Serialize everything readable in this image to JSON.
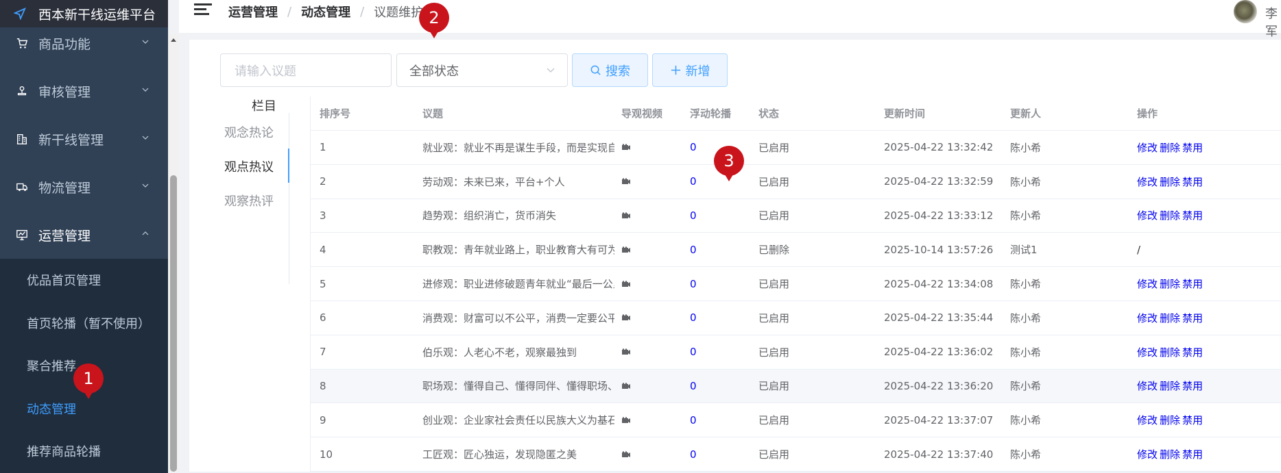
{
  "app_title": "西本新干线运维平台",
  "sidebar": {
    "items": [
      {
        "label": "商品功能",
        "icon": "cart-icon"
      },
      {
        "label": "审核管理",
        "icon": "stamp-icon"
      },
      {
        "label": "新干线管理",
        "icon": "building-icon"
      },
      {
        "label": "物流管理",
        "icon": "truck-icon"
      },
      {
        "label": "运营管理",
        "icon": "monitor-icon"
      }
    ],
    "subitems": [
      {
        "label": "优品首页管理"
      },
      {
        "label": "首页轮播（暂不使用）"
      },
      {
        "label": "聚合推荐"
      },
      {
        "label": "动态管理"
      },
      {
        "label": "推荐商品轮播"
      }
    ]
  },
  "header": {
    "breadcrumb": [
      "运营管理",
      "动态管理",
      "议题维护"
    ],
    "username": "李军"
  },
  "badges": [
    "1",
    "2",
    "3"
  ],
  "filters": {
    "search_placeholder": "请输入议题",
    "status_value": "全部状态",
    "search_label": "搜索",
    "add_label": "新增"
  },
  "categories": {
    "heading": "栏目",
    "items": [
      "观念热论",
      "观点热议",
      "观察热评"
    ],
    "active_index": 1
  },
  "table": {
    "columns": [
      "排序号",
      "议题",
      "导观视频",
      "浮动轮播",
      "状态",
      "更新时间",
      "更新人",
      "操作"
    ],
    "rows": [
      {
        "no": "1",
        "title": "就业观：就业不再是谋生手段，而是实现自我价值",
        "carousel": "0",
        "status": "已启用",
        "time": "2025-04-22 13:32:42",
        "user": "陈小希",
        "ops": [
          "修改",
          "删除",
          "禁用"
        ]
      },
      {
        "no": "2",
        "title": "劳动观：未来已来，平台+个人",
        "carousel": "0",
        "status": "已启用",
        "time": "2025-04-22 13:32:59",
        "user": "陈小希",
        "ops": [
          "修改",
          "删除",
          "禁用"
        ]
      },
      {
        "no": "3",
        "title": "趋势观：组织消亡，货币消失",
        "carousel": "0",
        "status": "已启用",
        "time": "2025-04-22 13:33:12",
        "user": "陈小希",
        "ops": [
          "修改",
          "删除",
          "禁用"
        ]
      },
      {
        "no": "4",
        "title": "职教观：青年就业路上，职业教育大有可为",
        "carousel": "0",
        "status": "已删除",
        "time": "2025-10-14 13:57:26",
        "user": "测试1",
        "ops_text": "/"
      },
      {
        "no": "5",
        "title": "进修观：职业进修破题青年就业“最后一公里”",
        "carousel": "0",
        "status": "已启用",
        "time": "2025-04-22 13:34:08",
        "user": "陈小希",
        "ops": [
          "修改",
          "删除",
          "禁用"
        ]
      },
      {
        "no": "6",
        "title": "消费观：财富可以不公平，消费一定要公平",
        "carousel": "0",
        "status": "已启用",
        "time": "2025-04-22 13:35:44",
        "user": "陈小希",
        "ops": [
          "修改",
          "删除",
          "禁用"
        ]
      },
      {
        "no": "7",
        "title": "伯乐观：人老心不老，观察最独到",
        "carousel": "0",
        "status": "已启用",
        "time": "2025-04-22 13:36:02",
        "user": "陈小希",
        "ops": [
          "修改",
          "删除",
          "禁用"
        ]
      },
      {
        "no": "8",
        "title": "职场观：懂得自己、懂得同伴、懂得职场、懂得社会",
        "carousel": "0",
        "status": "已启用",
        "time": "2025-04-22 13:36:20",
        "user": "陈小希",
        "ops": [
          "修改",
          "删除",
          "禁用"
        ]
      },
      {
        "no": "9",
        "title": "创业观：企业家社会责任以民族大义为基石",
        "carousel": "0",
        "status": "已启用",
        "time": "2025-04-22 13:37:07",
        "user": "陈小希",
        "ops": [
          "修改",
          "删除",
          "禁用"
        ]
      },
      {
        "no": "10",
        "title": "工匠观：匠心独运，发现隐匿之美",
        "carousel": "0",
        "status": "已启用",
        "time": "2025-04-22 13:37:40",
        "user": "陈小希",
        "ops": [
          "修改",
          "删除",
          "禁用"
        ]
      }
    ]
  },
  "colors": {
    "sidebar_bg": "#304156",
    "accent": "#409eff",
    "badge": "#c9141c",
    "link": "#0000ee"
  }
}
